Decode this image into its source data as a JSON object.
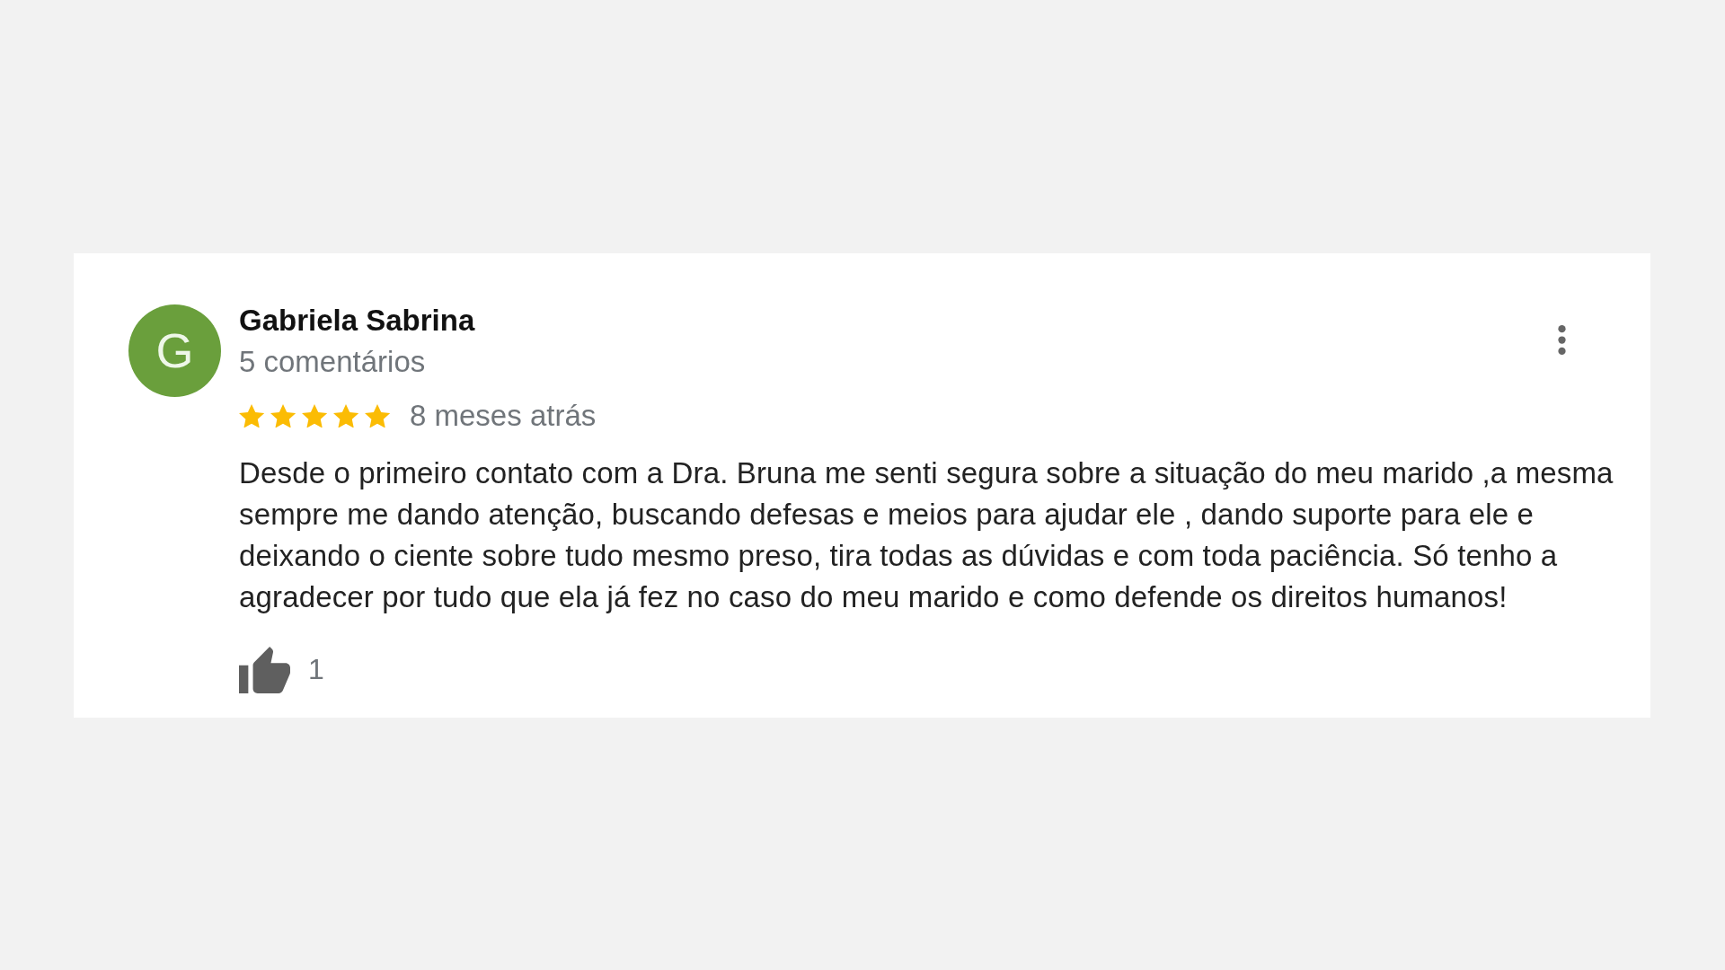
{
  "review": {
    "author": {
      "initial": "G",
      "name": "Gabriela Sabrina",
      "review_count": "5 comentários"
    },
    "stars": 5,
    "time": "8 meses atrás",
    "text": "Desde o primeiro contato com a Dra. Bruna me senti segura sobre a situação do meu marido ,a mesma sempre me dando atenção, buscando defesas e meios para ajudar ele , dando suporte para ele e deixando o ciente sobre tudo mesmo preso, tira todas as dúvidas e com toda paciência. Só tenho a agradecer por tudo que ela já fez no caso do meu marido e como defende os direitos humanos!",
    "likes": "1"
  }
}
